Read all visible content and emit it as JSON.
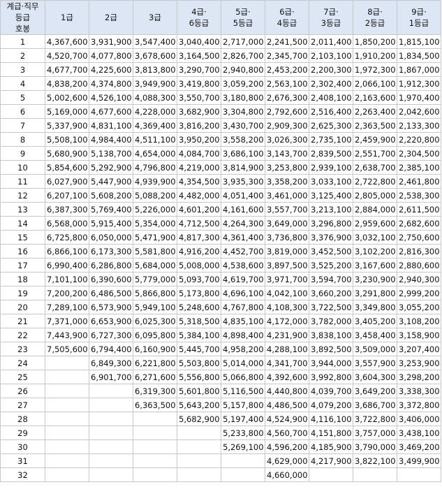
{
  "header": {
    "corner": [
      "계급·직무",
      "등급",
      "호봉"
    ],
    "columns": [
      [
        "1급"
      ],
      [
        "2급"
      ],
      [
        "3급"
      ],
      [
        "4급·",
        "6등급"
      ],
      [
        "5급·",
        "5등급"
      ],
      [
        "6급·",
        "4등급"
      ],
      [
        "7급·",
        "3등급"
      ],
      [
        "8급·",
        "2등급"
      ],
      [
        "9급·",
        "1등급"
      ]
    ]
  },
  "rows": [
    {
      "step": "1",
      "values": [
        "4,367,600",
        "3,931,900",
        "3,547,400",
        "3,040,400",
        "2,717,000",
        "2,241,500",
        "2,011,400",
        "1,850,200",
        "1,815,100"
      ]
    },
    {
      "step": "2",
      "values": [
        "4,520,700",
        "4,077,800",
        "3,678,600",
        "3,164,500",
        "2,826,700",
        "2,345,700",
        "2,103,100",
        "1,910,200",
        "1,834,500"
      ]
    },
    {
      "step": "3",
      "values": [
        "4,677,700",
        "4,225,600",
        "3,813,800",
        "3,290,700",
        "2,940,800",
        "2,453,200",
        "2,200,300",
        "1,972,300",
        "1,867,000"
      ]
    },
    {
      "step": "4",
      "values": [
        "4,838,200",
        "4,374,800",
        "3,949,900",
        "3,419,800",
        "3,059,200",
        "2,563,100",
        "2,302,400",
        "2,066,100",
        "1,912,300"
      ]
    },
    {
      "step": "5",
      "values": [
        "5,002,600",
        "4,526,100",
        "4,088,300",
        "3,550,700",
        "3,180,800",
        "2,676,300",
        "2,408,100",
        "2,163,600",
        "1,970,400"
      ]
    },
    {
      "step": "6",
      "values": [
        "5,169,000",
        "4,677,600",
        "4,228,000",
        "3,682,900",
        "3,304,800",
        "2,792,600",
        "2,516,400",
        "2,263,400",
        "2,042,600"
      ]
    },
    {
      "step": "7",
      "values": [
        "5,337,900",
        "4,831,100",
        "4,369,400",
        "3,816,200",
        "3,430,700",
        "2,909,300",
        "2,625,300",
        "2,363,500",
        "2,133,300"
      ]
    },
    {
      "step": "8",
      "values": [
        "5,508,100",
        "4,984,400",
        "4,511,100",
        "3,950,200",
        "3,558,200",
        "3,026,300",
        "2,735,100",
        "2,459,900",
        "2,220,800"
      ]
    },
    {
      "step": "9",
      "values": [
        "5,680,900",
        "5,138,700",
        "4,654,000",
        "4,084,700",
        "3,686,100",
        "3,143,700",
        "2,839,500",
        "2,551,700",
        "2,304,500"
      ]
    },
    {
      "step": "10",
      "values": [
        "5,854,600",
        "5,292,900",
        "4,796,800",
        "4,219,000",
        "3,814,900",
        "3,253,800",
        "2,939,100",
        "2,638,700",
        "2,385,100"
      ]
    },
    {
      "step": "11",
      "values": [
        "6,027,900",
        "5,447,900",
        "4,939,900",
        "4,354,500",
        "3,935,300",
        "3,358,200",
        "3,033,100",
        "2,722,800",
        "2,461,800"
      ]
    },
    {
      "step": "12",
      "values": [
        "6,207,100",
        "5,608,200",
        "5,088,200",
        "4,482,000",
        "4,051,400",
        "3,461,000",
        "3,125,400",
        "2,805,000",
        "2,538,300"
      ]
    },
    {
      "step": "13",
      "values": [
        "6,387,300",
        "5,769,400",
        "5,226,000",
        "4,601,200",
        "4,161,600",
        "3,557,700",
        "3,213,100",
        "2,884,000",
        "2,611,500"
      ]
    },
    {
      "step": "14",
      "values": [
        "6,568,000",
        "5,915,400",
        "5,354,000",
        "4,712,500",
        "4,264,300",
        "3,649,000",
        "3,296,800",
        "2,959,600",
        "2,682,600"
      ]
    },
    {
      "step": "15",
      "values": [
        "6,725,800",
        "6,050,000",
        "5,471,900",
        "4,817,300",
        "4,361,400",
        "3,736,800",
        "3,376,900",
        "3,032,100",
        "2,750,600"
      ]
    },
    {
      "step": "16",
      "values": [
        "6,866,100",
        "6,173,300",
        "5,581,800",
        "4,916,200",
        "4,452,700",
        "3,819,000",
        "3,452,500",
        "3,102,200",
        "2,816,300"
      ]
    },
    {
      "step": "17",
      "values": [
        "6,990,400",
        "6,286,800",
        "5,684,000",
        "5,008,000",
        "4,538,600",
        "3,897,500",
        "3,525,200",
        "3,167,600",
        "2,880,600"
      ]
    },
    {
      "step": "18",
      "values": [
        "7,101,100",
        "6,390,600",
        "5,779,000",
        "5,093,700",
        "4,619,700",
        "3,971,700",
        "3,594,700",
        "3,230,900",
        "2,940,300"
      ]
    },
    {
      "step": "19",
      "values": [
        "7,200,200",
        "6,486,500",
        "5,866,800",
        "5,173,800",
        "4,696,100",
        "4,042,100",
        "3,660,200",
        "3,291,800",
        "2,999,200"
      ]
    },
    {
      "step": "20",
      "values": [
        "7,289,100",
        "6,573,900",
        "5,949,100",
        "5,248,600",
        "4,767,800",
        "4,108,300",
        "3,722,500",
        "3,349,800",
        "3,055,200"
      ]
    },
    {
      "step": "21",
      "values": [
        "7,371,000",
        "6,653,900",
        "6,025,300",
        "5,318,500",
        "4,835,100",
        "4,172,000",
        "3,782,000",
        "3,405,200",
        "3,108,200"
      ]
    },
    {
      "step": "22",
      "values": [
        "7,443,900",
        "6,727,300",
        "6,095,800",
        "5,384,100",
        "4,898,400",
        "4,231,900",
        "3,838,100",
        "3,458,400",
        "3,158,900"
      ]
    },
    {
      "step": "23",
      "values": [
        "7,505,600",
        "6,794,400",
        "6,160,900",
        "5,445,700",
        "4,958,200",
        "4,288,100",
        "3,892,500",
        "3,509,000",
        "3,207,400"
      ]
    },
    {
      "step": "24",
      "values": [
        "",
        "6,849,300",
        "6,221,800",
        "5,503,800",
        "5,014,000",
        "4,341,700",
        "3,944,000",
        "3,557,900",
        "3,253,900"
      ]
    },
    {
      "step": "25",
      "values": [
        "",
        "6,901,700",
        "6,271,600",
        "5,556,800",
        "5,066,800",
        "4,392,600",
        "3,992,800",
        "3,604,300",
        "3,298,200"
      ]
    },
    {
      "step": "26",
      "values": [
        "",
        "",
        "6,319,300",
        "5,601,800",
        "5,116,500",
        "4,440,800",
        "4,039,700",
        "3,649,200",
        "3,338,300"
      ]
    },
    {
      "step": "27",
      "values": [
        "",
        "",
        "6,363,500",
        "5,643,200",
        "5,157,800",
        "4,486,500",
        "4,079,200",
        "3,686,700",
        "3,372,800"
      ]
    },
    {
      "step": "28",
      "values": [
        "",
        "",
        "",
        "5,682,900",
        "5,197,400",
        "4,524,900",
        "4,116,100",
        "3,722,800",
        "3,406,000"
      ]
    },
    {
      "step": "29",
      "values": [
        "",
        "",
        "",
        "",
        "5,233,800",
        "4,560,700",
        "4,151,800",
        "3,757,000",
        "3,438,100"
      ]
    },
    {
      "step": "30",
      "values": [
        "",
        "",
        "",
        "",
        "5,269,100",
        "4,596,200",
        "4,185,900",
        "3,790,000",
        "3,469,200"
      ]
    },
    {
      "step": "31",
      "values": [
        "",
        "",
        "",
        "",
        "",
        "4,629,000",
        "4,217,900",
        "3,822,100",
        "3,499,900"
      ]
    },
    {
      "step": "32",
      "values": [
        "",
        "",
        "",
        "",
        "",
        "4,660,000",
        "",
        "",
        ""
      ]
    }
  ]
}
